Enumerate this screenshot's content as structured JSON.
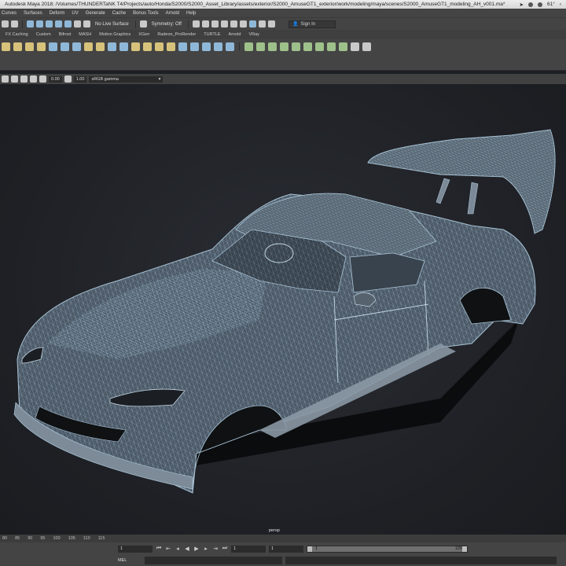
{
  "window": {
    "title": "Autodesk Maya 2018: /Volumes/THUNDERTaNK T4/Projects/auto/Honda/S2000/S2000_Asset_Library/assets/exterior/S2000_AmuseGT1_exterior/work/modeling/maya/scenes/S2000_AmuseGT1_modeling_AH_v001.ma*",
    "temperature": "61°"
  },
  "menu": [
    "Curves",
    "Surfaces",
    "Deform",
    "UV",
    "Generate",
    "Cache",
    "Bonus Tools",
    "Arnold",
    "Help"
  ],
  "status": {
    "live_surface": "No Live Surface",
    "symmetry": "Symmetry: Off",
    "sign_in": "Sign In"
  },
  "shelf_tabs": [
    "FX Caching",
    "Custom",
    "Bifrost",
    "MASH",
    "Motion Graphics",
    "XGen",
    "Radeon_ProRender",
    "TURTLE",
    "Arnold",
    "VRay"
  ],
  "shelf_active": "",
  "panel": {
    "exposure": "0.00",
    "gamma": "1.00",
    "color_space": "sRGB gamma"
  },
  "viewport": {
    "camera": "persp",
    "wire_color": "#8fb0c6",
    "shade_color": "#4d5966"
  },
  "timeline": {
    "ticks": [
      "80",
      "85",
      "90",
      "95",
      "100",
      "105",
      "110",
      "115"
    ],
    "current": "1"
  },
  "range": {
    "start": "1",
    "anim_start": "1",
    "bar_start": "1",
    "bar_end": "120"
  },
  "command": {
    "label": "MEL"
  }
}
